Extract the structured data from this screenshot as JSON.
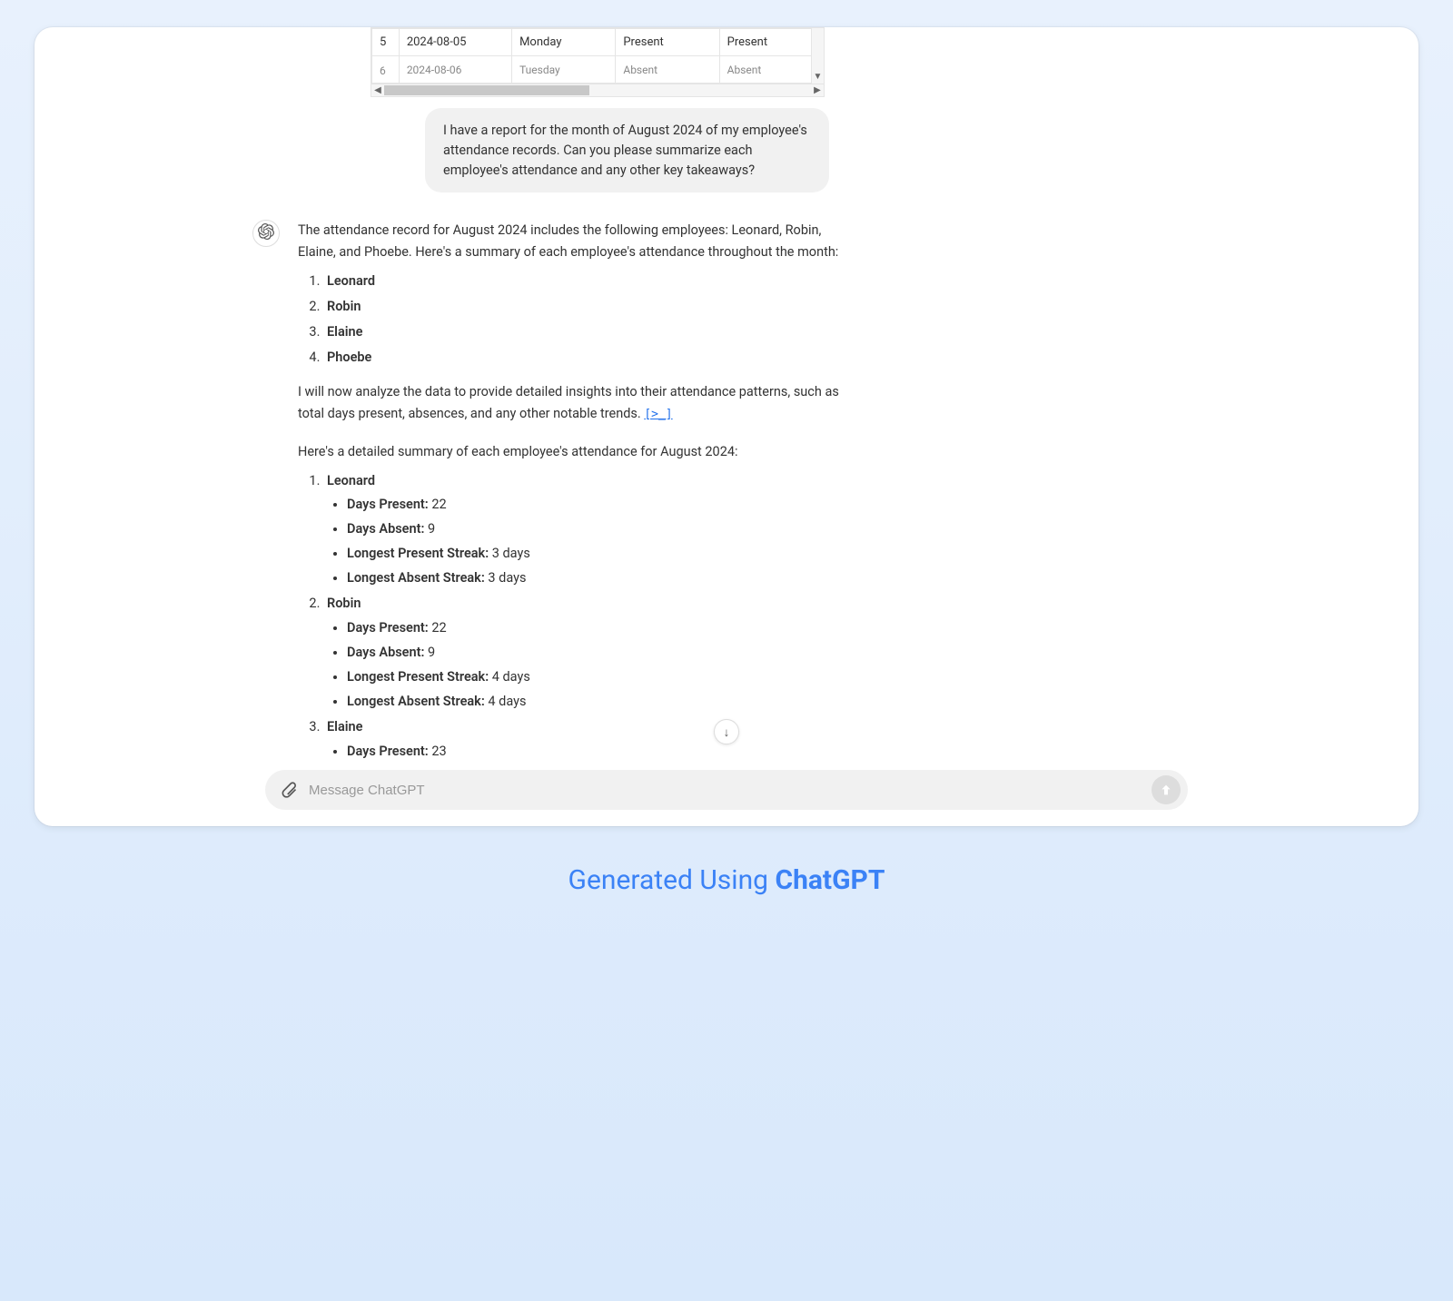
{
  "table": {
    "row1": {
      "idx": "5",
      "date": "2024-08-05",
      "day": "Monday",
      "c1": "Present",
      "c2": "Present"
    },
    "row2": {
      "idx": "6",
      "date": "2024-08-06",
      "day": "Tuesday",
      "c1": "Absent",
      "c2": "Absent"
    }
  },
  "user_message": "I have a report for the month of August 2024 of my employee's attendance records. Can you please summarize each employee's attendance and any other key takeaways?",
  "assistant": {
    "intro": "The attendance record for August 2024 includes the following employees: Leonard, Robin, Elaine, and Phoebe. Here's a summary of each employee's attendance throughout the month:",
    "names": [
      "Leonard",
      "Robin",
      "Elaine",
      "Phoebe"
    ],
    "analysis_pre": "I will now analyze the data to provide detailed insights into their attendance patterns, such as total days present, absences, and any other notable trends. ",
    "code_link": "[>_]",
    "summary_intro": "Here's a detailed summary of each employee's attendance for August 2024:",
    "details": [
      {
        "name": "Leonard",
        "stats": [
          {
            "label": "Days Present:",
            "value": " 22"
          },
          {
            "label": "Days Absent:",
            "value": " 9"
          },
          {
            "label": "Longest Present Streak:",
            "value": " 3 days"
          },
          {
            "label": "Longest Absent Streak:",
            "value": " 3 days"
          }
        ]
      },
      {
        "name": "Robin",
        "stats": [
          {
            "label": "Days Present:",
            "value": " 22"
          },
          {
            "label": "Days Absent:",
            "value": " 9"
          },
          {
            "label": "Longest Present Streak:",
            "value": " 4 days"
          },
          {
            "label": "Longest Absent Streak:",
            "value": " 4 days"
          }
        ]
      },
      {
        "name": "Elaine",
        "stats": [
          {
            "label": "Days Present:",
            "value": " 23"
          }
        ]
      }
    ]
  },
  "input": {
    "placeholder": "Message ChatGPT"
  },
  "caption_prefix": "Generated Using ",
  "caption_brand": "ChatGPT"
}
